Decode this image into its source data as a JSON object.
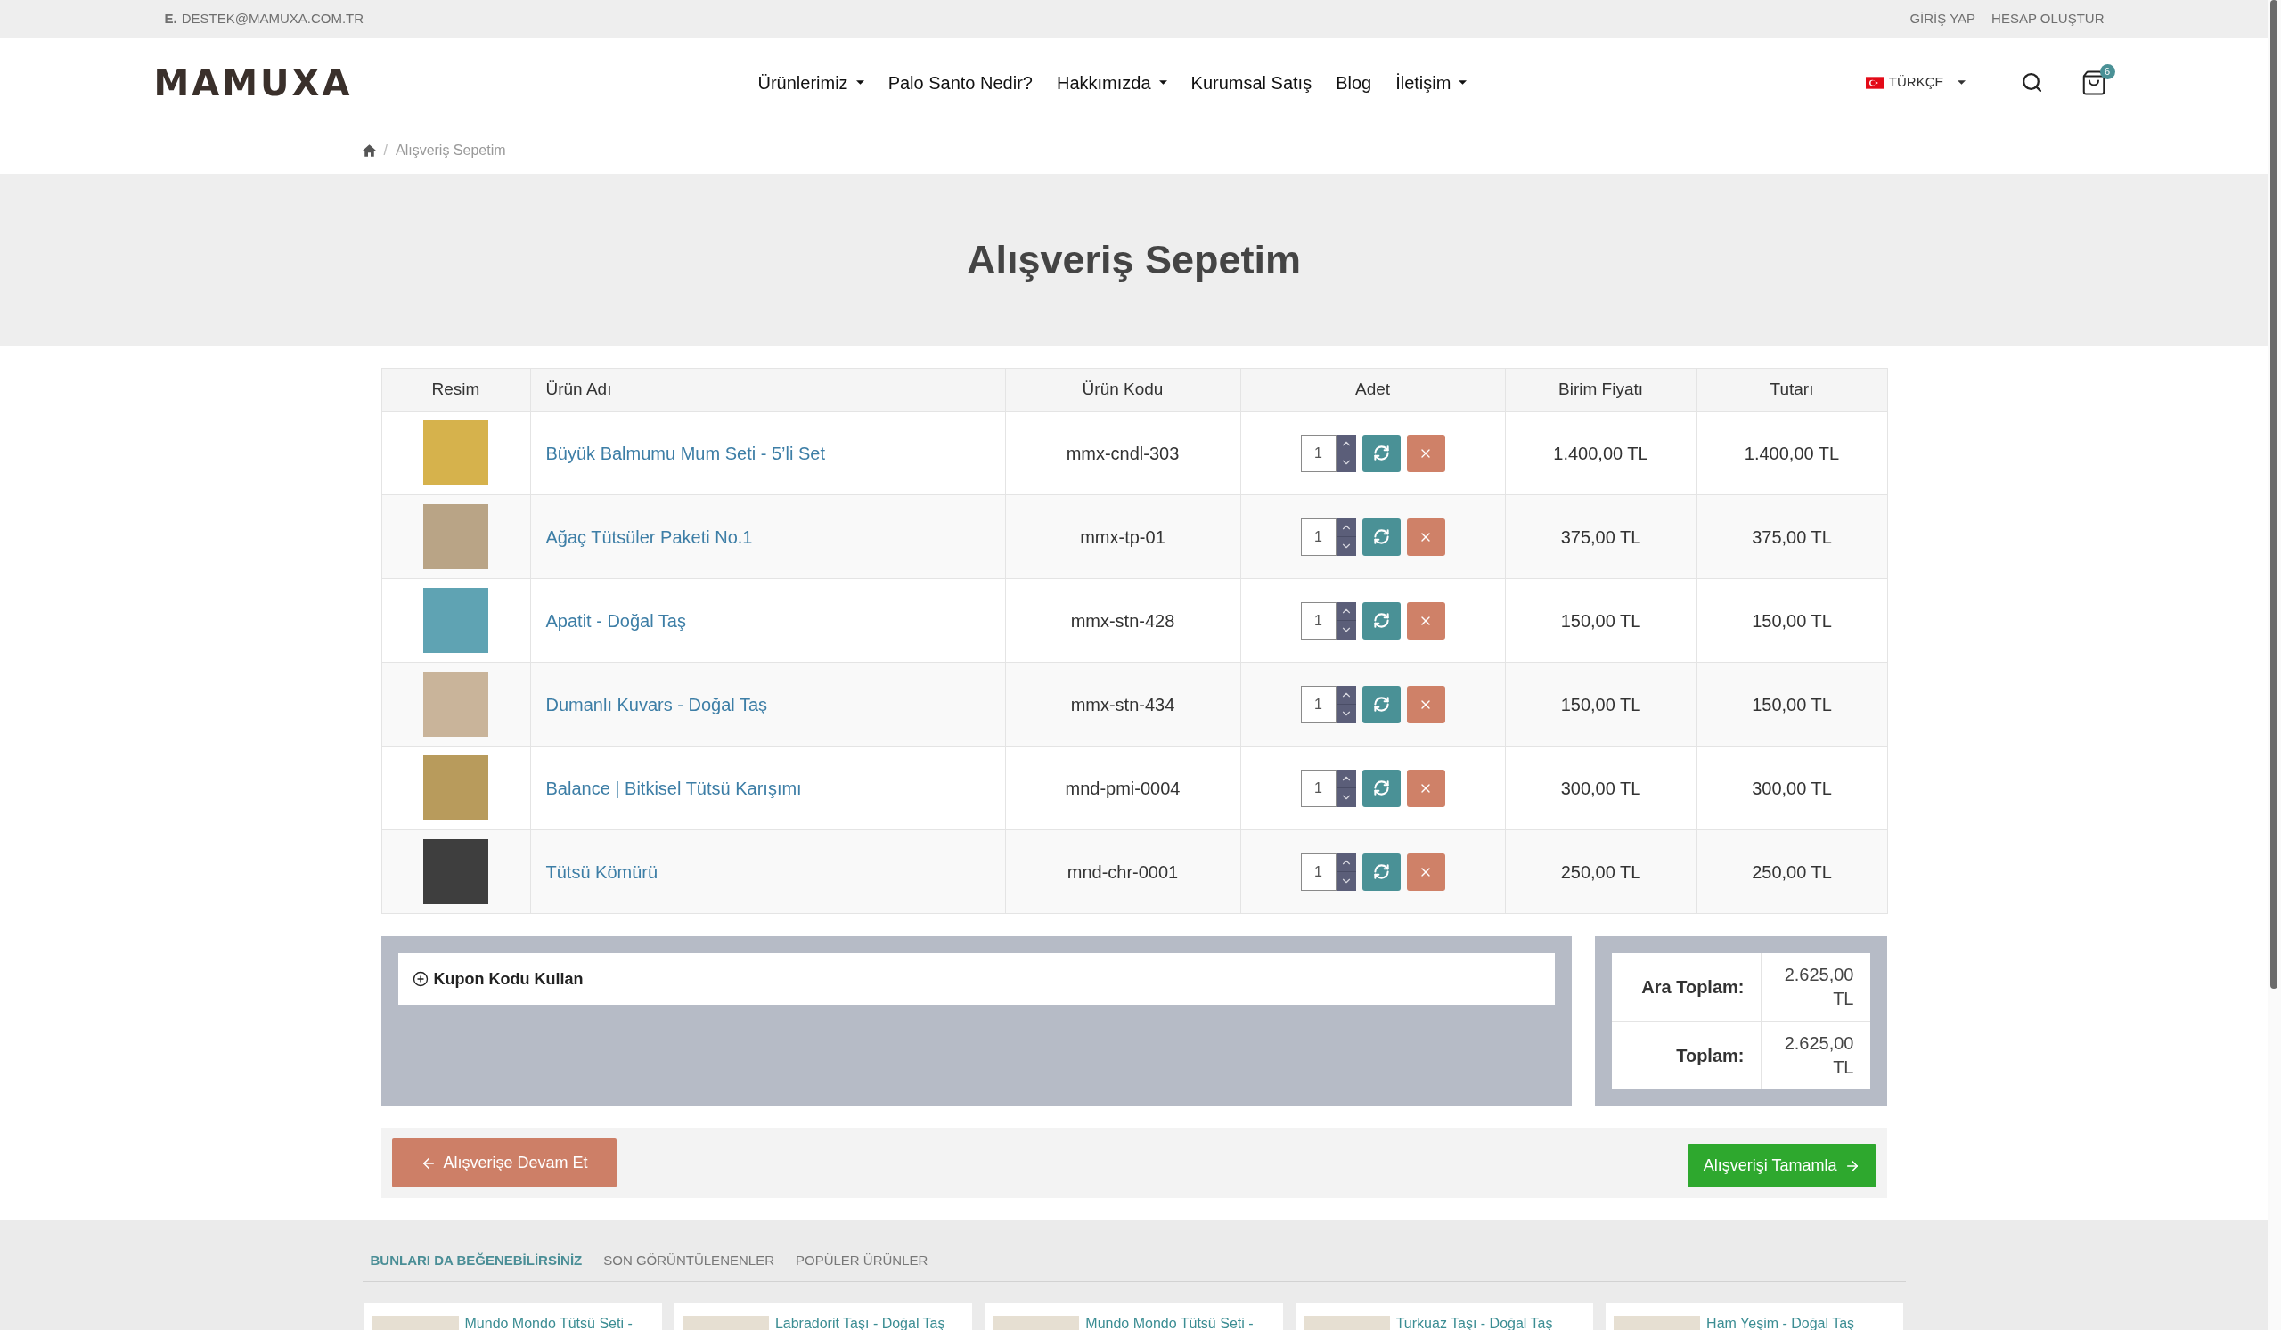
{
  "top_bar": {
    "email_label": "E.",
    "email": "DESTEK@MAMUXA.COM.TR",
    "links": [
      "GİRİŞ YAP",
      "HESAP OLUŞTUR"
    ]
  },
  "header": {
    "logo": "MAMUXA",
    "nav": [
      {
        "label": "Ürünlerimiz",
        "dropdown": true
      },
      {
        "label": "Palo Santo Nedir?",
        "dropdown": false
      },
      {
        "label": "Hakkımızda",
        "dropdown": true
      },
      {
        "label": "Kurumsal Satış",
        "dropdown": false
      },
      {
        "label": "Blog",
        "dropdown": false
      },
      {
        "label": "İletişim",
        "dropdown": true
      }
    ],
    "language": "TÜRKÇE",
    "cart_count": "6"
  },
  "breadcrumb": {
    "separator": "/",
    "current": "Alışveriş Sepetim"
  },
  "page_title": "Alışveriş Sepetim",
  "cart_table": {
    "columns": [
      "Resim",
      "Ürün Adı",
      "Ürün Kodu",
      "Adet",
      "Birim Fiyatı",
      "Tutarı"
    ],
    "rows": [
      {
        "name": "Büyük Balmumu Mum Seti - 5’li Set",
        "code": "mmx-cndl-303",
        "quantity": "1",
        "unit_price": "1.400,00 TL",
        "total": "1.400,00 TL"
      },
      {
        "name": "Ağaç Tütsüler Paketi No.1",
        "code": "mmx-tp-01",
        "quantity": "1",
        "unit_price": "375,00 TL",
        "total": "375,00 TL"
      },
      {
        "name": "Apatit - Doğal Taş",
        "code": "mmx-stn-428",
        "quantity": "1",
        "unit_price": "150,00 TL",
        "total": "150,00 TL"
      },
      {
        "name": "Dumanlı Kuvars - Doğal Taş",
        "code": "mmx-stn-434",
        "quantity": "1",
        "unit_price": "150,00 TL",
        "total": "150,00 TL"
      },
      {
        "name": "Balance | Bitkisel Tütsü Karışımı",
        "code": "mnd-pmi-0004",
        "quantity": "1",
        "unit_price": "300,00 TL",
        "total": "300,00 TL"
      },
      {
        "name": "Tütsü Kömürü",
        "code": "mnd-chr-0001",
        "quantity": "1",
        "unit_price": "250,00 TL",
        "total": "250,00 TL"
      }
    ]
  },
  "coupon": {
    "label": "Kupon Kodu Kullan"
  },
  "totals": [
    {
      "label": "Ara Toplam:",
      "value": "2.625,00 TL"
    },
    {
      "label": "Toplam:",
      "value": "2.625,00 TL"
    }
  ],
  "actions": {
    "continue": "Alışverişe Devam Et",
    "checkout": "Alışverişi Tamamla"
  },
  "recommendations": {
    "tabs": [
      {
        "label": "BUNLARI DA BEĞENEBİLİRSİNİZ",
        "selected": true
      },
      {
        "label": "SON GÖRÜNTÜLENENLER",
        "selected": false
      },
      {
        "label": "POPÜLER ÜRÜNLER",
        "selected": false
      }
    ],
    "items": [
      "Mundo Mondo Tütsü Seti -",
      "Labradorit Taşı - Doğal Taş",
      "Mundo Mondo Tütsü Seti -",
      "Turkuaz Taşı - Doğal Taş",
      "Ham Yeşim - Doğal Taş"
    ]
  }
}
